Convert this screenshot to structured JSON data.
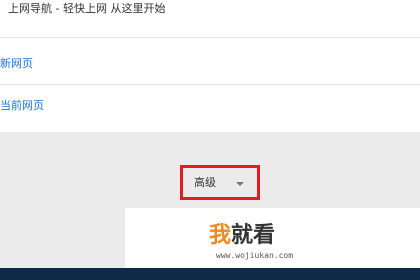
{
  "header": {
    "title": "上网导航 - 轻快上网 从这里开始"
  },
  "menu": {
    "items": [
      {
        "label": "新网页"
      },
      {
        "label": "当前网页"
      }
    ]
  },
  "advanced_button": {
    "label": "高级",
    "icon": "chevron-down-icon",
    "highlight_color": "#e02020"
  },
  "watermark": {
    "logo_part1": "我",
    "logo_part2": "就看",
    "url": "www.wojiukan.com",
    "accent_color": "#f08a1c"
  },
  "colors": {
    "link": "#1a73e8",
    "background": "#ebebeb",
    "footer": "#0e2a47"
  }
}
